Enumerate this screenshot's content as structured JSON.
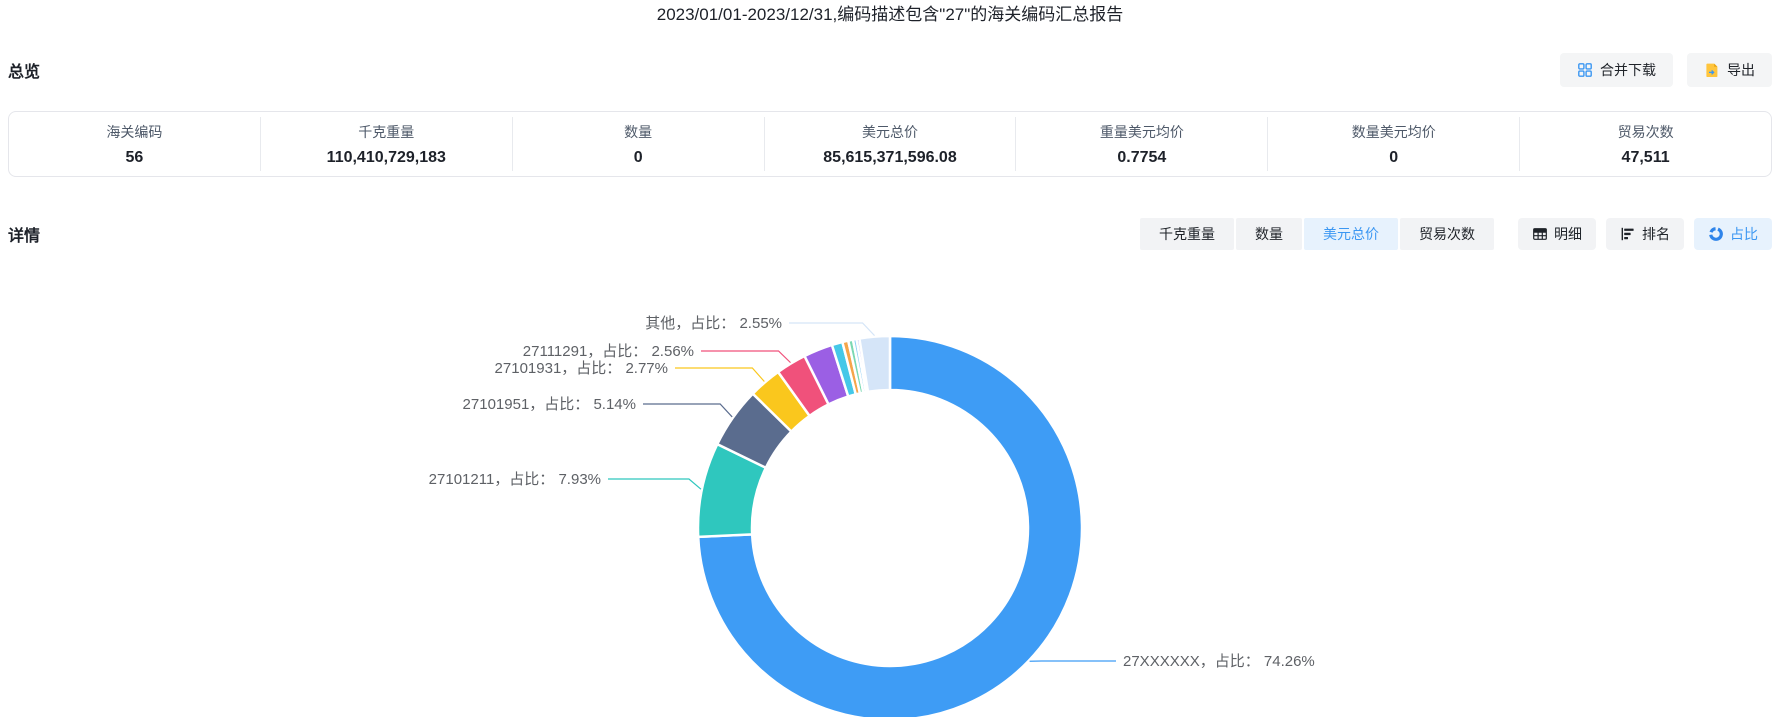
{
  "title": "2023/01/01-2023/12/31,编码描述包含\"27\"的海关编码汇总报告",
  "overview": {
    "heading": "总览",
    "buttons": {
      "merge_download": "合并下载",
      "merge_download_icon": "grid-squares-icon",
      "export": "导出",
      "export_icon": "export-file-icon"
    },
    "stats": [
      {
        "key": "customs-code",
        "label": "海关编码",
        "value": "56"
      },
      {
        "key": "kg-weight",
        "label": "千克重量",
        "value": "110,410,729,183"
      },
      {
        "key": "quantity",
        "label": "数量",
        "value": "0"
      },
      {
        "key": "usd-total",
        "label": "美元总价",
        "value": "85,615,371,596.08"
      },
      {
        "key": "weight-usd-avg",
        "label": "重量美元均价",
        "value": "0.7754"
      },
      {
        "key": "quantity-usd-avg",
        "label": "数量美元均价",
        "value": "0"
      },
      {
        "key": "trade-count",
        "label": "贸易次数",
        "value": "47,511"
      }
    ]
  },
  "detail": {
    "heading": "详情",
    "metric_tabs": [
      {
        "key": "kg-weight",
        "label": "千克重量",
        "active": false
      },
      {
        "key": "quantity",
        "label": "数量",
        "active": false
      },
      {
        "key": "usd-total",
        "label": "美元总价",
        "active": true
      },
      {
        "key": "trade-count",
        "label": "贸易次数",
        "active": false
      }
    ],
    "view_buttons": [
      {
        "key": "detail",
        "label": "明细",
        "icon": "table-icon",
        "active": false
      },
      {
        "key": "ranking",
        "label": "排名",
        "icon": "ranking-icon",
        "active": false
      },
      {
        "key": "proportion",
        "label": "占比",
        "icon": "donut-icon",
        "active": true
      }
    ]
  },
  "colors": {
    "accent_blue": "#3b97f2",
    "active_tab_bg": "#e7f2fd",
    "button_bg": "#f2f3f5",
    "border": "#e5e6eb",
    "chart_label_text": "#5e6166",
    "export_icon_orange": "#ffc53d"
  },
  "chart_data": {
    "type": "pie",
    "variant": "donut",
    "metric": "美元总价",
    "value_unit": "占比 %",
    "note": "Slices ordered clockwise from 12 o'clock. Unlabeled thin slivers between the purple slice and 其他 are visually estimated so the total equals 100%.",
    "segments": [
      {
        "code": "27XXXXXX",
        "value_percent": 74.26,
        "color": "#3e9cf5",
        "label_text": "27XXXXXX，占比： 74.26%"
      },
      {
        "code": "27101211",
        "value_percent": 7.93,
        "color": "#2fc7be",
        "label_text": "27101211，占比： 7.93%"
      },
      {
        "code": "27101951",
        "value_percent": 5.14,
        "color": "#5a6c8e",
        "label_text": "27101951，占比： 5.14%"
      },
      {
        "code": "27101931",
        "value_percent": 2.77,
        "color": "#fac71d",
        "label_text": "27101931，占比： 2.77%"
      },
      {
        "code": "27111291",
        "value_percent": 2.56,
        "color": "#f0517b",
        "label_text": "27111291，占比： 2.56%"
      },
      {
        "code": "unlabeled-1",
        "value_percent": 2.45,
        "color": "#9b5fe4",
        "estimated": true
      },
      {
        "code": "unlabeled-2",
        "value_percent": 0.9,
        "color": "#45c8e8",
        "estimated": true
      },
      {
        "code": "unlabeled-3",
        "value_percent": 0.5,
        "color": "#f5a54a",
        "estimated": true
      },
      {
        "code": "unlabeled-4",
        "value_percent": 0.4,
        "color": "#7bd8b2",
        "estimated": true
      },
      {
        "code": "unlabeled-5",
        "value_percent": 0.3,
        "color": "#8ecff5",
        "estimated": true
      },
      {
        "code": "unlabeled-6",
        "value_percent": 0.24,
        "color": "#b9a6f0",
        "estimated": true
      },
      {
        "code": "其他",
        "value_percent": 2.55,
        "color": "#d5e5f8",
        "label_text": "其他，占比： 2.55%"
      }
    ]
  }
}
